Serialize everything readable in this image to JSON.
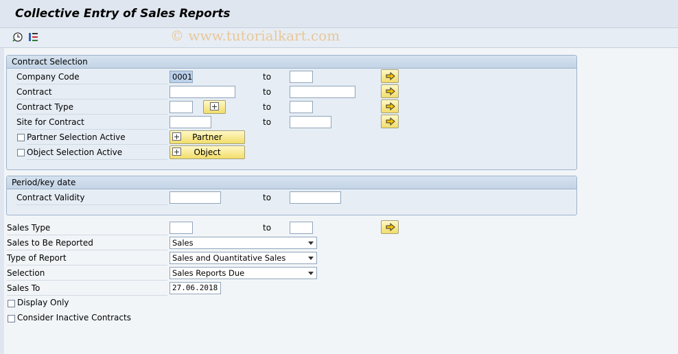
{
  "title": "Collective Entry of Sales Reports",
  "watermark": "© www.tutorialkart.com",
  "toolbar": {
    "icons": [
      "execute-clock-icon",
      "selection-options-icon"
    ]
  },
  "contract_selection": {
    "header": "Contract Selection",
    "rows": [
      {
        "label": "Company Code",
        "from": "0001",
        "to_label": "to",
        "to": ""
      },
      {
        "label": "Contract",
        "from": "",
        "to_label": "to",
        "to": ""
      },
      {
        "label": "Contract Type",
        "from": "",
        "to_label": "to",
        "to": ""
      },
      {
        "label": "Site for Contract",
        "from": "",
        "to_label": "to",
        "to": ""
      }
    ],
    "partner_selection_label": "Partner Selection Active",
    "object_selection_label": "Object Selection Active",
    "partner_button": "Partner",
    "object_button": "Object"
  },
  "period": {
    "header": "Period/key date",
    "contract_validity_label": "Contract Validity",
    "to_label": "to",
    "from": "",
    "to": ""
  },
  "sales": {
    "sales_type_label": "Sales Type",
    "to_label": "to",
    "sales_to_be_reported_label": "Sales to Be Reported",
    "sales_to_be_reported_value": "Sales",
    "type_of_report_label": "Type of Report",
    "type_of_report_value": "Sales and Quantitative Sales",
    "selection_label": "Selection",
    "selection_value": "Sales Reports Due",
    "sales_to_label": "Sales To",
    "sales_to_value": "27.06.2018",
    "display_only_label": "Display Only",
    "consider_inactive_label": "Consider Inactive Contracts"
  }
}
